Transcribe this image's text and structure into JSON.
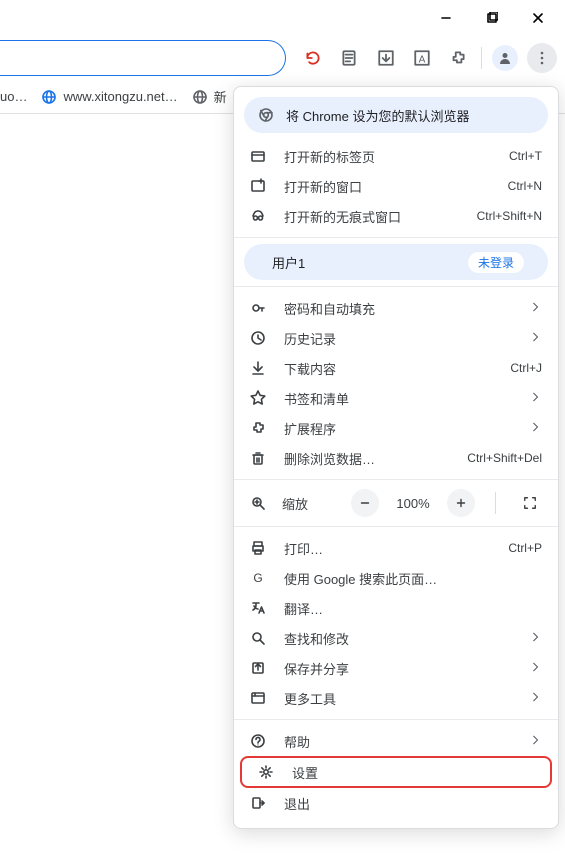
{
  "bookmarks": {
    "item1_text": "uo…",
    "item2_text": "www.xitongzu.net…",
    "item3_text": "新"
  },
  "menu": {
    "default_browser_label": "将 Chrome 设为您的默认浏览器",
    "new_tab": {
      "label": "打开新的标签页",
      "shortcut": "Ctrl+T"
    },
    "new_window": {
      "label": "打开新的窗口",
      "shortcut": "Ctrl+N"
    },
    "incognito": {
      "label": "打开新的无痕式窗口",
      "shortcut": "Ctrl+Shift+N"
    },
    "user": {
      "name": "用户1",
      "status": "未登录"
    },
    "passwords": {
      "label": "密码和自动填充"
    },
    "history": {
      "label": "历史记录"
    },
    "downloads": {
      "label": "下载内容",
      "shortcut": "Ctrl+J"
    },
    "bookmarks": {
      "label": "书签和清单"
    },
    "extensions": {
      "label": "扩展程序"
    },
    "clear_data": {
      "label": "删除浏览数据…",
      "shortcut": "Ctrl+Shift+Del"
    },
    "zoom": {
      "label": "缩放",
      "value": "100%"
    },
    "print": {
      "label": "打印…",
      "shortcut": "Ctrl+P"
    },
    "google_search": {
      "label": "使用 Google 搜索此页面…"
    },
    "translate": {
      "label": "翻译…"
    },
    "find_edit": {
      "label": "查找和修改"
    },
    "save_share": {
      "label": "保存并分享"
    },
    "more_tools": {
      "label": "更多工具"
    },
    "help": {
      "label": "帮助"
    },
    "settings": {
      "label": "设置"
    },
    "exit": {
      "label": "退出"
    }
  }
}
